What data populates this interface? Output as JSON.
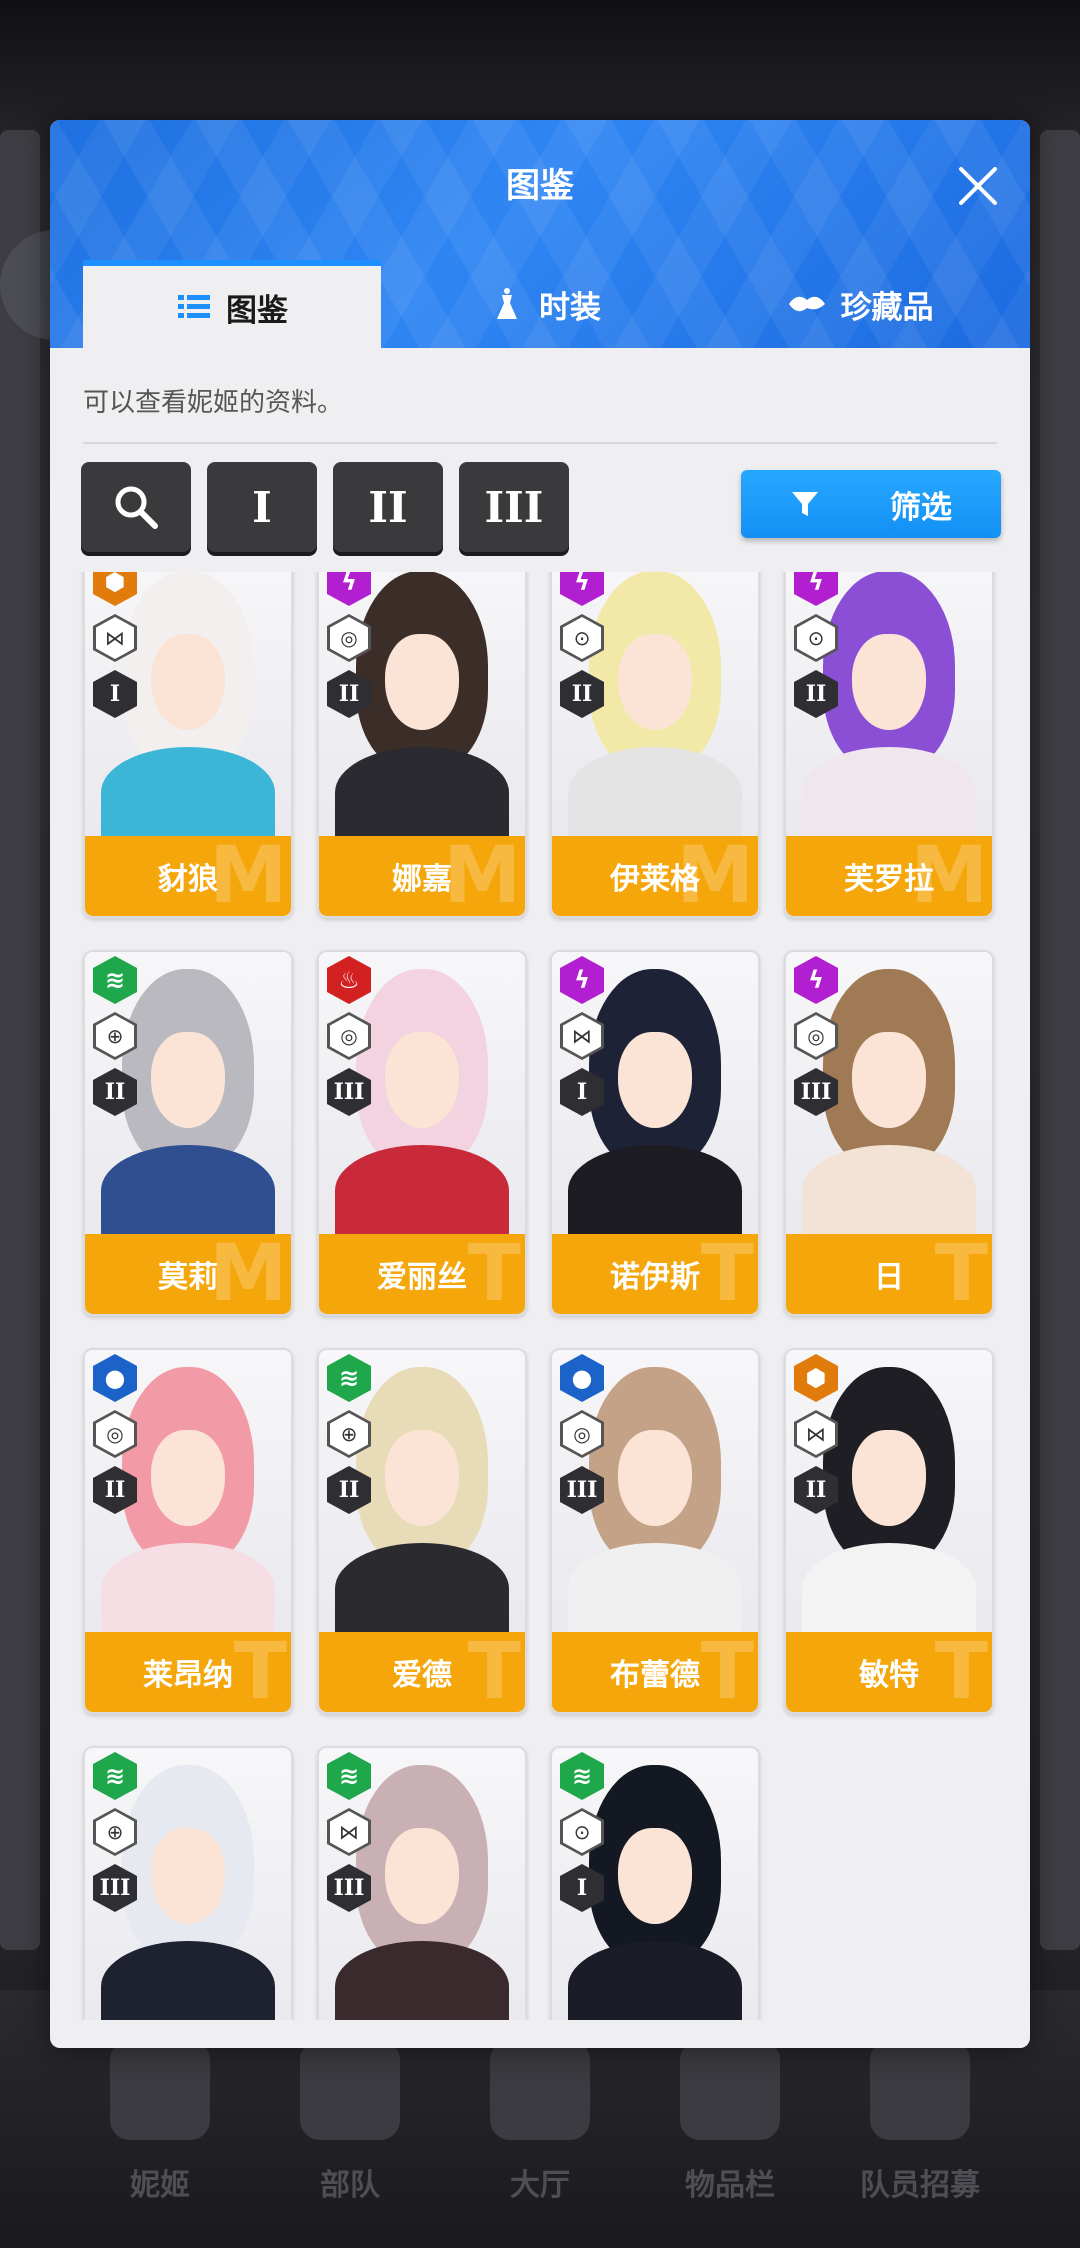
{
  "modal": {
    "title": "图鉴",
    "tabs": [
      {
        "label": "图鉴",
        "icon": "list-icon",
        "active": true
      },
      {
        "label": "时装",
        "icon": "dress-icon",
        "active": false
      },
      {
        "label": "珍藏品",
        "icon": "treasure-icon",
        "active": false
      }
    ],
    "subtitle": "可以查看妮姬的资料。",
    "burst_filters": [
      "I",
      "II",
      "III"
    ],
    "filter_label": "筛选"
  },
  "characters": [
    {
      "name": "豺狼",
      "element": "iron",
      "element_color": "#e07b0c",
      "burst": "I",
      "class_icon": "defender-icon",
      "hair": "#f2efee",
      "outfit": "#3cb6d6",
      "wm": "M"
    },
    {
      "name": "娜嘉",
      "element": "electric",
      "element_color": "#b21fd1",
      "burst": "II",
      "class_icon": "supporter-icon",
      "hair": "#3b2d28",
      "outfit": "#2a2a30",
      "wm": "M"
    },
    {
      "name": "伊莱格",
      "element": "electric",
      "element_color": "#b21fd1",
      "burst": "II",
      "class_icon": "attacker-icon",
      "hair": "#f2e8a8",
      "outfit": "#e4e4e4",
      "wm": "M"
    },
    {
      "name": "芙罗拉",
      "element": "electric",
      "element_color": "#b21fd1",
      "burst": "II",
      "class_icon": "attacker-icon",
      "hair": "#8a4fd4",
      "outfit": "#efe6ee",
      "wm": "M"
    },
    {
      "name": "莫莉",
      "element": "wind",
      "element_color": "#1fa84b",
      "burst": "II",
      "class_icon": "target-icon",
      "hair": "#b9b9bf",
      "outfit": "#2f4f90",
      "wm": "M"
    },
    {
      "name": "爱丽丝",
      "element": "fire",
      "element_color": "#d32020",
      "burst": "III",
      "class_icon": "supporter-icon",
      "hair": "#f2d3df",
      "outfit": "#c92a3a",
      "wm": "T"
    },
    {
      "name": "诺伊斯",
      "element": "electric",
      "element_color": "#b21fd1",
      "burst": "I",
      "class_icon": "defender-icon",
      "hair": "#1d2236",
      "outfit": "#1c1c22",
      "wm": "T"
    },
    {
      "name": "日",
      "element": "electric",
      "element_color": "#b21fd1",
      "burst": "III",
      "class_icon": "supporter-icon",
      "hair": "#a07a55",
      "outfit": "#f3e2d6",
      "wm": "T"
    },
    {
      "name": "莱昂纳",
      "element": "water",
      "element_color": "#1c63c9",
      "burst": "II",
      "class_icon": "supporter-icon",
      "hair": "#f29aa6",
      "outfit": "#f5dfe4",
      "wm": "T"
    },
    {
      "name": "爱德",
      "element": "wind",
      "element_color": "#1fa84b",
      "burst": "II",
      "class_icon": "target-icon",
      "hair": "#e8dcb8",
      "outfit": "#2b2b2f",
      "wm": "T"
    },
    {
      "name": "布蕾德",
      "element": "water",
      "element_color": "#1c63c9",
      "burst": "III",
      "class_icon": "supporter-icon",
      "hair": "#c4a288",
      "outfit": "#f0f0f0",
      "wm": "T"
    },
    {
      "name": "敏特",
      "element": "iron",
      "element_color": "#e07b0c",
      "burst": "II",
      "class_icon": "defender-icon",
      "hair": "#1e1e24",
      "outfit": "#f3f3f3",
      "wm": "T"
    },
    {
      "name": "",
      "element": "wind",
      "element_color": "#1fa84b",
      "burst": "III",
      "class_icon": "target-icon",
      "hair": "#e6eaf0",
      "outfit": "#1e2230",
      "wm": ""
    },
    {
      "name": "",
      "element": "wind",
      "element_color": "#1fa84b",
      "burst": "III",
      "class_icon": "defender-icon",
      "hair": "#c9b0b5",
      "outfit": "#3a2a2e",
      "wm": ""
    },
    {
      "name": "",
      "element": "wind",
      "element_color": "#1fa84b",
      "burst": "I",
      "class_icon": "attacker-icon",
      "hair": "#141822",
      "outfit": "#1a1d27",
      "wm": ""
    }
  ],
  "background_nav": [
    "妮姬",
    "部队",
    "大厅",
    "物品栏",
    "队员招募"
  ]
}
